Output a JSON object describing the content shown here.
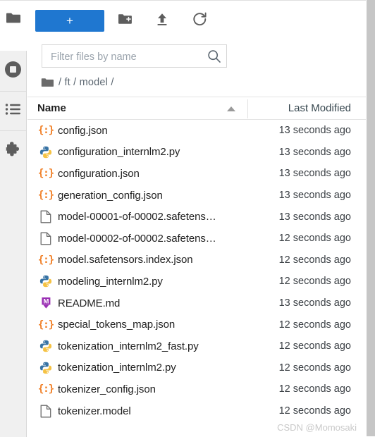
{
  "sidebar": {
    "tabs": [
      {
        "name": "file-browser",
        "icon": "folder-icon",
        "active": true
      },
      {
        "name": "running-sessions",
        "icon": "stop-circle-icon",
        "active": false
      },
      {
        "name": "commands-palette",
        "icon": "list-icon",
        "active": false
      },
      {
        "name": "extensions",
        "icon": "puzzle-piece-icon",
        "active": false
      }
    ]
  },
  "toolbar": {
    "new_launcher_label": "+",
    "new_folder_icon": "new-folder-icon",
    "upload_icon": "upload-icon",
    "refresh_icon": "refresh-icon",
    "accent_color": "#1f77d0"
  },
  "filter": {
    "placeholder": "Filter files by name",
    "value": "",
    "icon": "search-icon"
  },
  "breadcrumb": {
    "root_icon": "folder-icon",
    "path": "/ ft / model /"
  },
  "table": {
    "columns": {
      "name": "Name",
      "last_modified": "Last Modified"
    },
    "sort": {
      "column": "Name",
      "direction": "ascending"
    },
    "rows": [
      {
        "icon": "json-file-icon",
        "name": "config.json",
        "modified": "13 seconds ago"
      },
      {
        "icon": "python-file-icon",
        "name": "configuration_internlm2.py",
        "modified": "13 seconds ago"
      },
      {
        "icon": "json-file-icon",
        "name": "configuration.json",
        "modified": "13 seconds ago"
      },
      {
        "icon": "json-file-icon",
        "name": "generation_config.json",
        "modified": "13 seconds ago"
      },
      {
        "icon": "generic-file-icon",
        "name": "model-00001-of-00002.safetens…",
        "modified": "13 seconds ago"
      },
      {
        "icon": "generic-file-icon",
        "name": "model-00002-of-00002.safetens…",
        "modified": "12 seconds ago"
      },
      {
        "icon": "json-file-icon",
        "name": "model.safetensors.index.json",
        "modified": "12 seconds ago"
      },
      {
        "icon": "python-file-icon",
        "name": "modeling_internlm2.py",
        "modified": "12 seconds ago"
      },
      {
        "icon": "markdown-file-icon",
        "name": "README.md",
        "modified": "13 seconds ago"
      },
      {
        "icon": "json-file-icon",
        "name": "special_tokens_map.json",
        "modified": "12 seconds ago"
      },
      {
        "icon": "python-file-icon",
        "name": "tokenization_internlm2_fast.py",
        "modified": "12 seconds ago"
      },
      {
        "icon": "python-file-icon",
        "name": "tokenization_internlm2.py",
        "modified": "12 seconds ago"
      },
      {
        "icon": "json-file-icon",
        "name": "tokenizer_config.json",
        "modified": "12 seconds ago"
      },
      {
        "icon": "generic-file-icon",
        "name": "tokenizer.model",
        "modified": "12 seconds ago"
      }
    ]
  },
  "watermark": "CSDN @Momosaki"
}
